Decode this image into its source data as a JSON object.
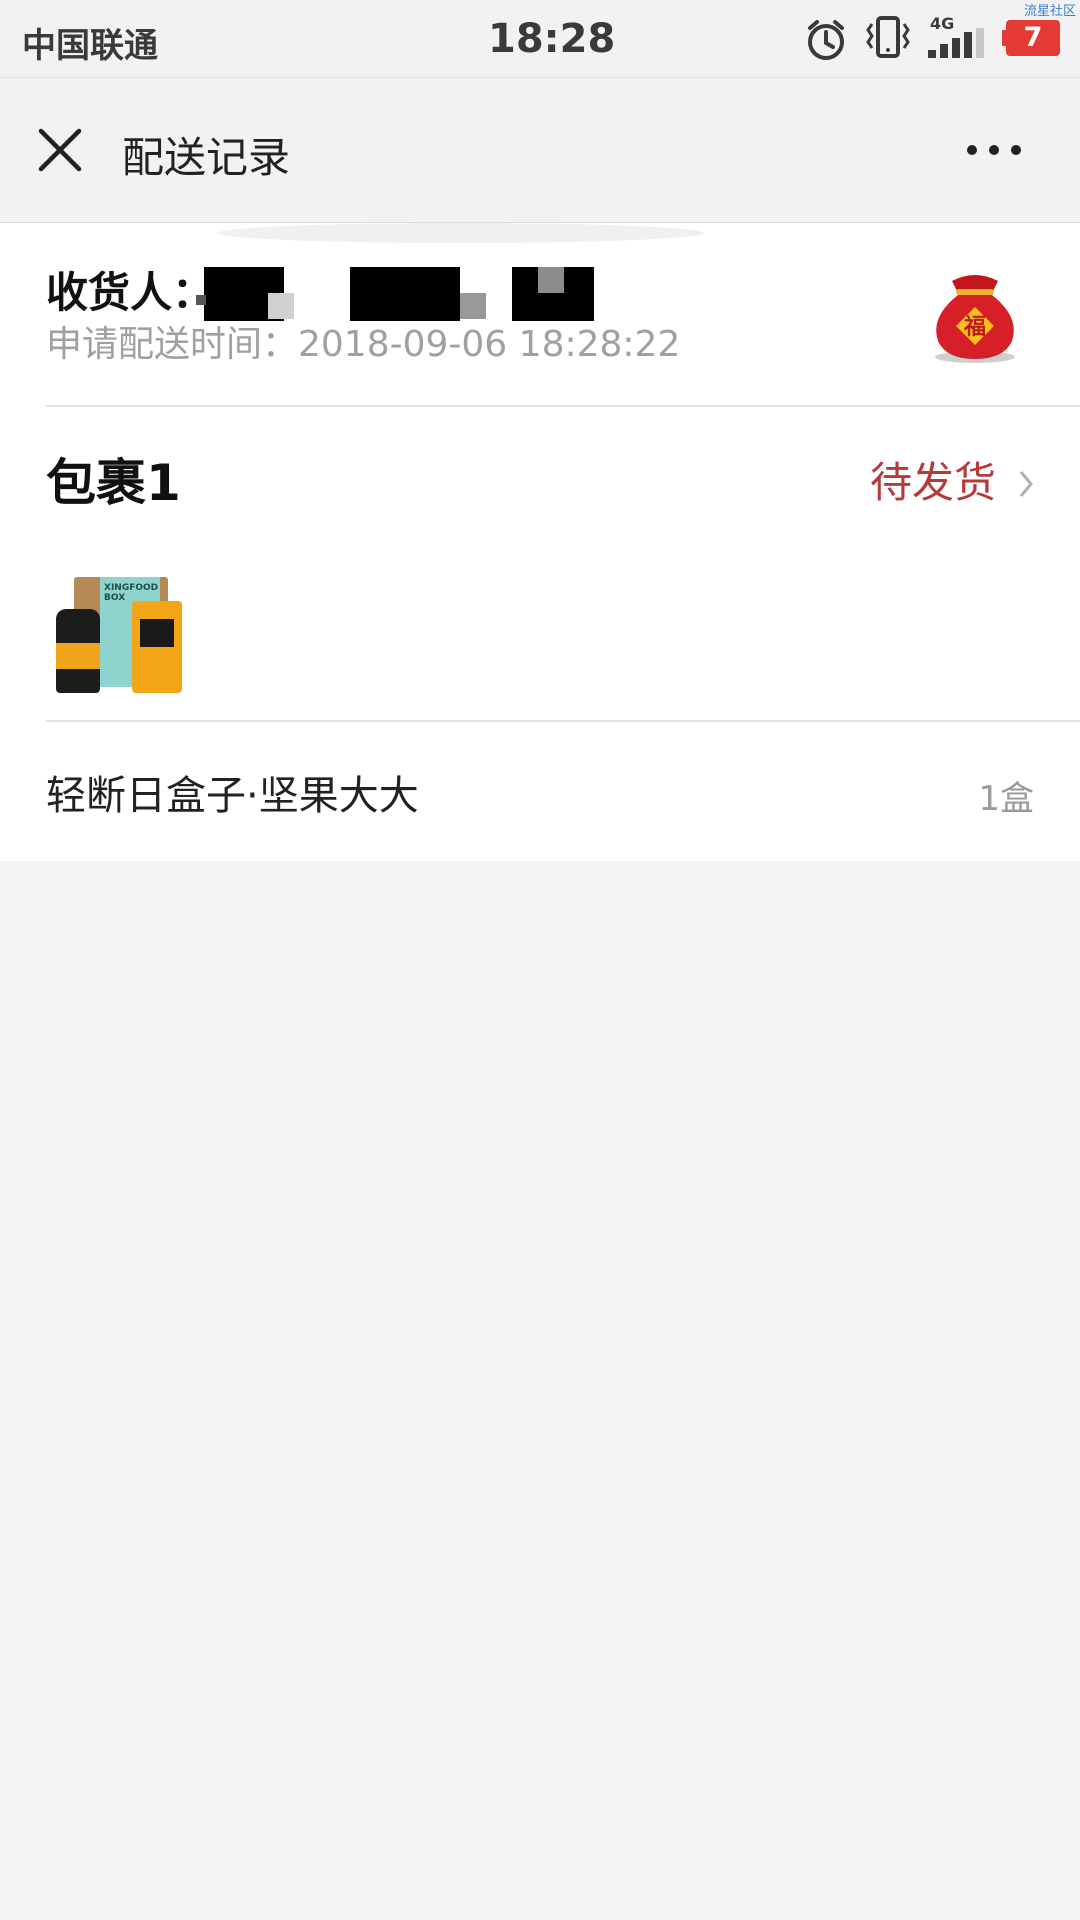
{
  "status_bar": {
    "carrier": "中国联通",
    "time": "18:28",
    "network": "4G",
    "battery": "7",
    "watermark": "流星社区"
  },
  "nav": {
    "title": "配送记录",
    "close_icon": "close-icon",
    "more_icon": "more-icon"
  },
  "delivery": {
    "recipient_label": "收货人：",
    "request_time_label": "申请配送时间：2018-09-06 18:28:22"
  },
  "package": {
    "title": "包裹1",
    "status": "待发货",
    "chevron_icon": "chevron-right-icon",
    "item_name": "轻断日盒子·坚果大大",
    "item_qty": "1盒"
  },
  "colors": {
    "accent_red": "#b53b3b",
    "battery_red": "#e53935"
  }
}
